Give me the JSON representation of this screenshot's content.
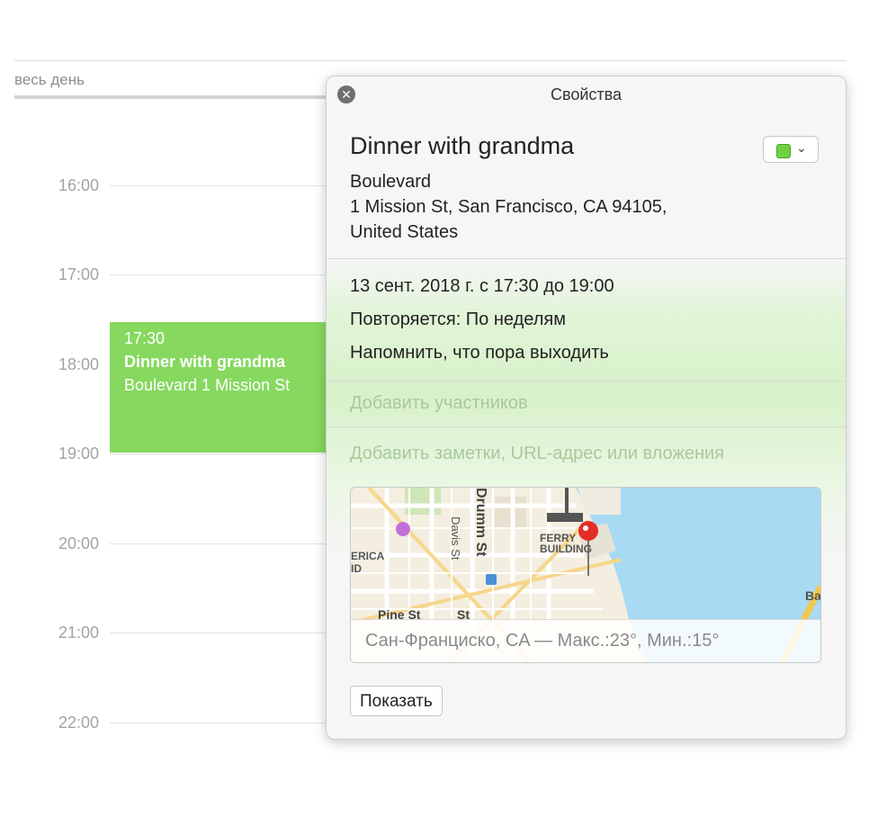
{
  "calendar": {
    "all_day_label": "весь день",
    "hours": [
      "16:00",
      "17:00",
      "18:00",
      "19:00",
      "20:00",
      "21:00",
      "22:00"
    ],
    "event": {
      "time": "17:30",
      "title": "Dinner with grandma",
      "location": "Boulevard 1 Mission St",
      "color": "#86d85f"
    }
  },
  "popover": {
    "title": "Свойства",
    "close_icon": "close-icon",
    "event_title": "Dinner with grandma",
    "calendar_color": "#6ed240",
    "address_lines": [
      "Boulevard",
      "1 Mission St, San Francisco, CA  94105,",
      "United States"
    ],
    "date_time": "13 сент. 2018 г.  с 17:30 до 19:00",
    "repeat": "Повторяется: По неделям",
    "travel_alert": "Напомнить, что пора выходить",
    "add_invitees": "Добавить участников",
    "add_notes": "Добавить заметки, URL-адрес или вложения",
    "map": {
      "labels": {
        "drumm": "Drumm St",
        "davis": "Davis St",
        "pine": "Pine St",
        "st": "St",
        "ferry1": "FERRY",
        "ferry2": "BUILDING",
        "erica": "ERICA",
        "id": "ID",
        "ba": "Ba"
      },
      "weather": "Сан-Франциско, CA — Макс.:23°, Мин.:15°"
    },
    "show_button": "Показать"
  }
}
